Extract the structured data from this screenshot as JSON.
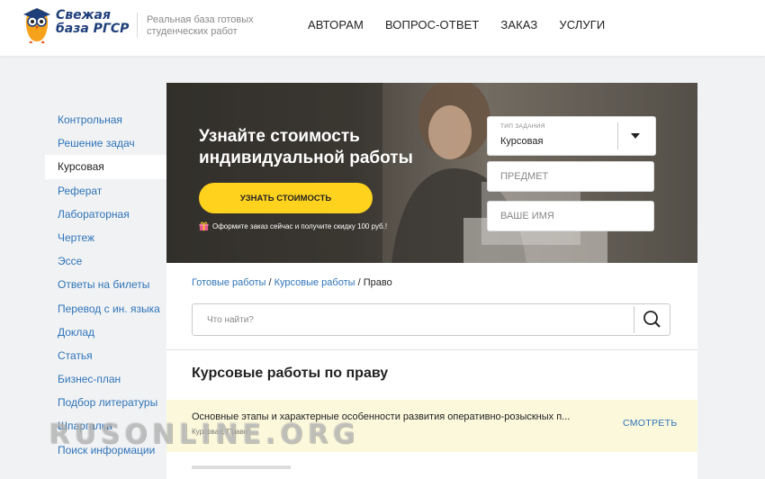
{
  "header": {
    "logo_text": "Свежая база РГСР",
    "tagline": "Реальная база готовых студенческих работ",
    "nav": [
      "АВТОРАМ",
      "ВОПРОС-ОТВЕТ",
      "ЗАКАЗ",
      "УСЛУГИ"
    ]
  },
  "sidebar": {
    "items": [
      {
        "label": "Контрольная",
        "active": false
      },
      {
        "label": "Решение задач",
        "active": false
      },
      {
        "label": "Курсовая",
        "active": true
      },
      {
        "label": "Реферат",
        "active": false
      },
      {
        "label": "Лабораторная",
        "active": false
      },
      {
        "label": "Чертеж",
        "active": false
      },
      {
        "label": "Эссе",
        "active": false
      },
      {
        "label": "Ответы на билеты",
        "active": false
      },
      {
        "label": "Перевод с ин. языка",
        "active": false
      },
      {
        "label": "Доклад",
        "active": false
      },
      {
        "label": "Статья",
        "active": false
      },
      {
        "label": "Бизнес-план",
        "active": false
      },
      {
        "label": "Подбор литературы",
        "active": false
      },
      {
        "label": "Шпаргалка",
        "active": false
      },
      {
        "label": "Поиск информации",
        "active": false
      }
    ]
  },
  "hero": {
    "title": "Узнайте стоимость индивидуальной работы",
    "button_label": "УЗНАТЬ СТОИМОСТЬ",
    "note": "Оформите заказ сейчас и получите скидку 100 руб.!",
    "form": {
      "type_label": "ТИП ЗАДАНИЯ",
      "type_value": "Курсовая",
      "subject_placeholder": "ПРЕДМЕТ",
      "name_placeholder": "ВАШЕ ИМЯ"
    }
  },
  "breadcrumb": {
    "items": [
      "Готовые работы",
      "Курсовые работы"
    ],
    "current": "Право",
    "separator": " / "
  },
  "search": {
    "placeholder": "Что найти?"
  },
  "section_title": "Курсовые работы по праву",
  "results": [
    {
      "title": "Основные этапы и характерные особенности развития оперативно-розыскных п...",
      "meta": "Курсовая, Право",
      "action": "СМОТРЕТЬ"
    }
  ],
  "watermark": "RUSONLINE.ORG",
  "colors": {
    "link": "#2f74b8",
    "accent_yellow": "#ffd21e",
    "highlight_row": "#fbf8dc",
    "logo_blue": "#1f3f7a"
  }
}
